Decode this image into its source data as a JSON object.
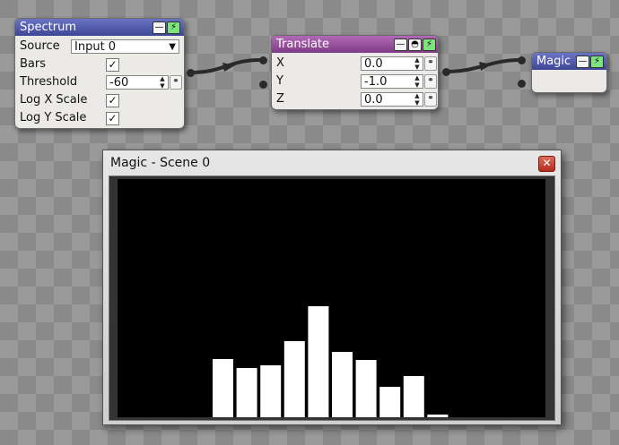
{
  "spectrum_node": {
    "title": "Spectrum",
    "source_label": "Source",
    "source_value": "Input 0",
    "bars_label": "Bars",
    "bars_checked": "✓",
    "threshold_label": "Threshold",
    "threshold_value": "-60",
    "log_x_label": "Log X Scale",
    "log_x_checked": "✓",
    "log_y_label": "Log Y Scale",
    "log_y_checked": "✓"
  },
  "translate_node": {
    "title": "Translate",
    "x_label": "X",
    "x_value": "0.0",
    "y_label": "Y",
    "y_value": "-1.0",
    "z_label": "Z",
    "z_value": "0.0"
  },
  "magic_node": {
    "title": "Magic"
  },
  "window": {
    "title": "Magic - Scene 0",
    "close_symbol": "✕"
  },
  "icons": {
    "minimize": "minimize-icon",
    "power": "power-icon",
    "eye": "preview-icon",
    "link": "link-icon",
    "dropdown": "chevron-down-icon"
  },
  "colors": {
    "node_blue": "#3e4796",
    "node_purple": "#803b87",
    "green_button": "#7de37d",
    "bar_color": "#ffffff"
  },
  "spectrum_bars": [
    0,
    0,
    0,
    0,
    0,
    0,
    0,
    0,
    0,
    0,
    65,
    55,
    58,
    85,
    124,
    73,
    64,
    34,
    46,
    3,
    0,
    0,
    0,
    0
  ]
}
